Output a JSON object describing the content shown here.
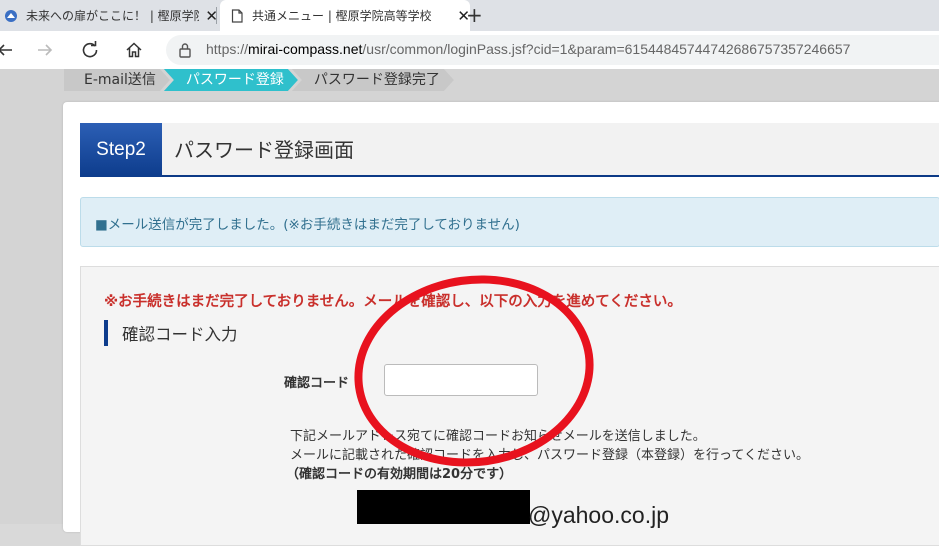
{
  "browser": {
    "tabs": [
      {
        "title": "未来への扉がここに！ | 樫原学院高",
        "active": false
      },
      {
        "title": "共通メニュー | 樫原学院高等学校",
        "active": true
      }
    ],
    "close_glyph": "✕",
    "new_tab_glyph": "+",
    "url_scheme": "https://",
    "url_domain": "mirai-compass.net",
    "url_path": "/usr/common/loginPass.jsf?cid=1&param=61544845744742686757357246657",
    "icons": {
      "back": "back-arrow-icon",
      "forward": "forward-arrow-icon",
      "reload": "reload-icon",
      "home": "home-icon",
      "lock": "lock-icon"
    }
  },
  "steps": [
    {
      "label": "E-mail送信",
      "state": "done"
    },
    {
      "label": "パスワード登録",
      "state": "active"
    },
    {
      "label": "パスワード登録完了",
      "state": "pending"
    }
  ],
  "header": {
    "step_badge": "Step2",
    "title": "パスワード登録画面"
  },
  "notice": "■メール送信が完了しました。(※お手続きはまだ完了しておりません)",
  "form": {
    "warning": "※お手続きはまだ完了しておりません。メールを確認し、以下の入力を進めてください。",
    "section_title": "確認コード入力",
    "code_label": "確認コード",
    "code_value": "",
    "info_line1": "下記メールアドレス宛てに確認コードお知らせメールを送信しました。",
    "info_line2": "メールに記載された確認コードを入力し、パスワード登録（本登録）を行ってください。",
    "info_line3": "（確認コードの有効期間は20分です）",
    "email_domain": "@yahoo.co.jp"
  },
  "colors": {
    "accent": "#2fc0cc",
    "navy": "#0d3c8c",
    "warning": "#c9302c",
    "circle": "#e8121e",
    "notice_bg": "#dfeef6"
  }
}
